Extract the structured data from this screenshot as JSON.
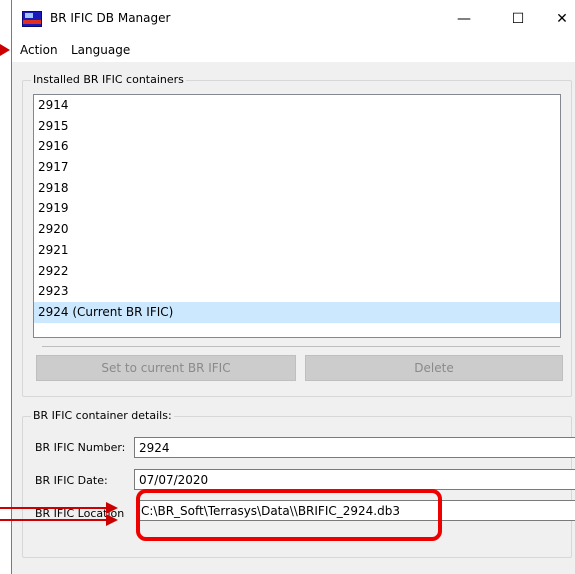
{
  "window": {
    "title": "BR IFIC DB Manager",
    "controls": {
      "minimize": "—",
      "maximize": "☐",
      "close": "✕"
    }
  },
  "menu": {
    "action": "Action",
    "language": "Language"
  },
  "installed": {
    "legend": "Installed BR IFIC containers",
    "items": [
      "2914",
      "2915",
      "2916",
      "2917",
      "2918",
      "2919",
      "2920",
      "2921",
      "2922",
      "2923",
      "2924 (Current BR IFIC)"
    ],
    "selected_index": 10,
    "set_current_label": "Set to current BR IFIC",
    "delete_label": "Delete"
  },
  "details": {
    "legend": "BR IFIC container details:",
    "number_label": "BR IFIC Number:",
    "number_value": "2924",
    "date_label": "BR IFIC Date:",
    "date_value": "07/07/2020",
    "location_label": "BR IFIC Location",
    "location_value": "C:\\BR_Soft\\Terrasys\\Data\\\\BRIFIC_2924.db3"
  },
  "colors": {
    "highlight": "#ee0000",
    "selection": "#cce8ff",
    "app_icon_blue": "#1a1ab8"
  }
}
